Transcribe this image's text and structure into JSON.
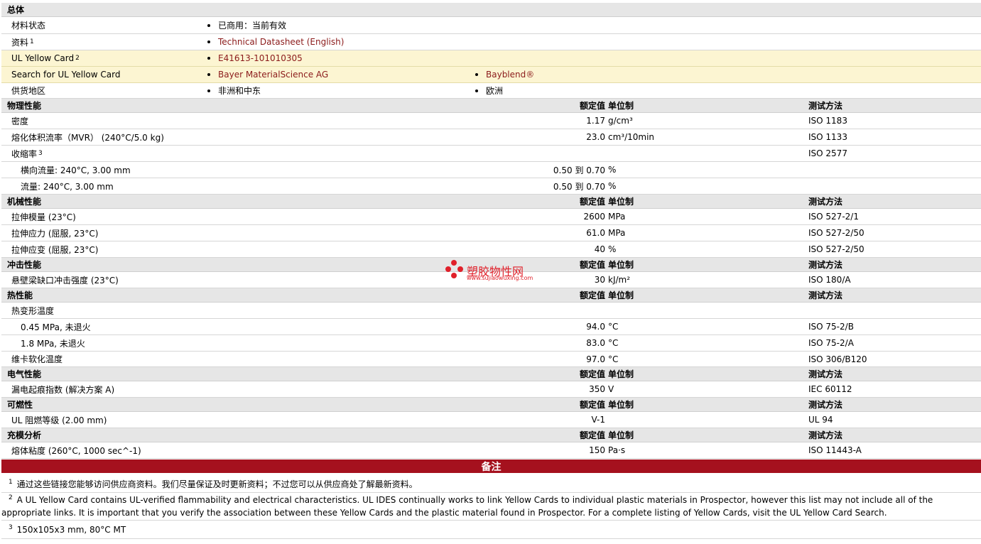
{
  "sections": {
    "general": {
      "title": "总体"
    },
    "physical": {
      "title": "物理性能",
      "col_value": "额定值",
      "col_unit": "单位制",
      "col_test": "测试方法"
    },
    "mechanical": {
      "title": "机械性能",
      "col_value": "额定值",
      "col_unit": "单位制",
      "col_test": "测试方法"
    },
    "impact": {
      "title": "冲击性能",
      "col_value": "额定值",
      "col_unit": "单位制",
      "col_test": "测试方法"
    },
    "thermal": {
      "title": "热性能",
      "col_value": "额定值",
      "col_unit": "单位制",
      "col_test": "测试方法"
    },
    "electrical": {
      "title": "电气性能",
      "col_value": "额定值",
      "col_unit": "单位制",
      "col_test": "测试方法"
    },
    "flammability": {
      "title": "可燃性",
      "col_value": "额定值",
      "col_unit": "单位制",
      "col_test": "测试方法"
    },
    "molding": {
      "title": "充模分析",
      "col_value": "额定值",
      "col_unit": "单位制",
      "col_test": "测试方法"
    }
  },
  "general": {
    "status_label": "材料状态",
    "status_value": "已商用：当前有效",
    "docs_label": "资料",
    "docs_sup": "1",
    "docs_link": "Technical Datasheet (English)",
    "ul_label": "UL Yellow Card",
    "ul_sup": "2",
    "ul_link": "E41613-101010305",
    "search_label": "Search for UL Yellow Card",
    "search_link1": "Bayer MaterialScience AG",
    "search_link2": "Bayblend®",
    "supply_label": "供货地区",
    "supply_value1": "非洲和中东",
    "supply_value2": "欧洲"
  },
  "physical": [
    {
      "label": "密度",
      "value": "1.17",
      "unit": "g/cm³",
      "test": "ISO 1183"
    },
    {
      "label": "熔化体积流率（MVR） (240°C/5.0 kg)",
      "value": "23.0",
      "unit": "cm³/10min",
      "test": "ISO 1133"
    },
    {
      "label": "收缩率",
      "sup": "3",
      "value": "",
      "unit": "",
      "test": "ISO 2577"
    },
    {
      "label": "横向流量: 240°C, 3.00 mm",
      "value": "0.50 到  0.70",
      "unit": "%",
      "test": ""
    },
    {
      "label": "流量: 240°C, 3.00 mm",
      "value": "0.50 到  0.70",
      "unit": "%",
      "test": ""
    }
  ],
  "mechanical": [
    {
      "label": "拉伸模量 (23°C)",
      "value": "2600",
      "unit": "MPa",
      "test": "ISO 527-2/1"
    },
    {
      "label": "拉伸应力 (屈服, 23°C)",
      "value": "61.0",
      "unit": "MPa",
      "test": "ISO 527-2/50"
    },
    {
      "label": "拉伸应变 (屈服, 23°C)",
      "value": "40",
      "unit": "%",
      "test": "ISO 527-2/50"
    }
  ],
  "impact": [
    {
      "label": "悬壁梁缺口冲击强度 (23°C)",
      "value": "30",
      "unit": "kJ/m²",
      "test": "ISO 180/A"
    }
  ],
  "thermal": [
    {
      "label": "热变形温度",
      "value": "",
      "unit": "",
      "test": ""
    },
    {
      "label": "0.45 MPa, 未退火",
      "value": "94.0",
      "unit": "°C",
      "test": "ISO 75-2/B"
    },
    {
      "label": "1.8 MPa, 未退火",
      "value": "83.0",
      "unit": "°C",
      "test": "ISO 75-2/A"
    },
    {
      "label": "维卡软化温度",
      "value": "97.0",
      "unit": "°C",
      "test": "ISO 306/B120"
    }
  ],
  "electrical": [
    {
      "label": "漏电起痕指数 (解决方案 A)",
      "value": "350",
      "unit": "V",
      "test": "IEC 60112"
    }
  ],
  "flammability": [
    {
      "label": "UL 阻燃等级 (2.00 mm)",
      "value": "V-1",
      "unit": "",
      "test": "UL 94"
    }
  ],
  "molding": [
    {
      "label": "熔体粘度 (260°C, 1000 sec^-1)",
      "value": "150",
      "unit": "Pa·s",
      "test": "ISO 11443-A"
    }
  ],
  "notes": {
    "title": "备注",
    "n1_sup": "1",
    "n1": "通过这些链接您能够访问供应商资料。我们尽量保证及时更新资料；不过您可以从供应商处了解最新资料。",
    "n2_sup": "2",
    "n2": "A UL Yellow Card contains UL-verified flammability and electrical characteristics. UL IDES continually works to link Yellow Cards to individual plastic materials in Prospector, however this list may not include all of the appropriate links. It is important that you verify the association between these Yellow Cards and the plastic material found in Prospector. For a complete listing of Yellow Cards, visit the UL Yellow Card Search.",
    "n3_sup": "3",
    "n3": "150x105x3 mm, 80°C MT"
  },
  "watermark": {
    "text": "塑胶物性网",
    "url": "www.sujiaowuxing.com",
    "color": "#e0202a"
  },
  "colors": {
    "notes_bar": "#a5111e",
    "link": "#8b1a1a",
    "highlight_row": "#fcf5d2",
    "header_row": "#e6e6e6"
  }
}
